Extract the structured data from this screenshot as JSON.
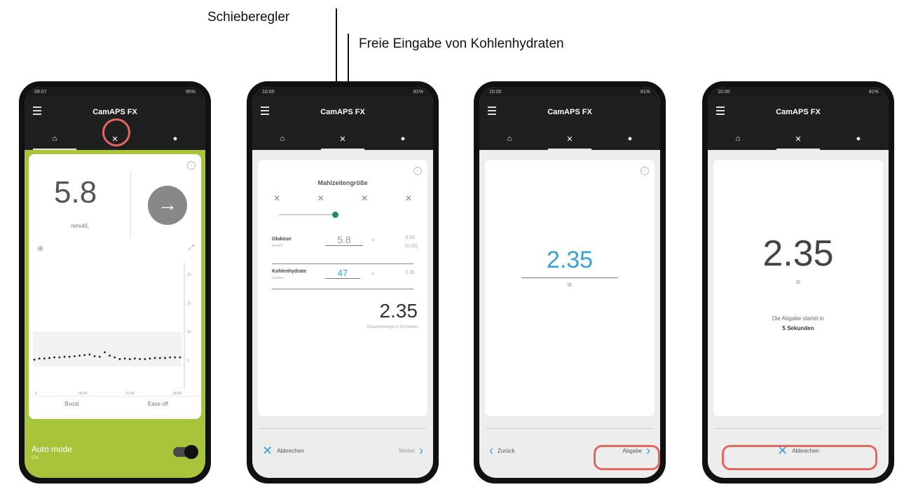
{
  "callouts": {
    "slider": "Schieberegler",
    "free_input": "Freie Eingabe von Kohlenhydraten"
  },
  "app": {
    "title": "CamAPS FX"
  },
  "screen1": {
    "status_left": "09:07",
    "status_right": "95%",
    "glucose_value": "5.8",
    "glucose_unit": "mmol/L",
    "y_ticks": [
      "20",
      "15",
      "10",
      "5"
    ],
    "x_ticks": [
      "3",
      "06:00",
      "07:00",
      "08:00"
    ],
    "boost_label": "Boost",
    "ease_off_label": "Ease off",
    "auto_mode_label": "Auto mode",
    "auto_mode_state": "On"
  },
  "screen2": {
    "status_left": "10:00",
    "status_right": "81%",
    "meal_size_title": "Mahlzeitengröße",
    "glucose_label": "Glukose",
    "glucose_sub": "mmol/L",
    "glucose_value": "5.8",
    "glucose_units": "0.00",
    "glucose_units2": "(0.00)",
    "carbs_label": "Kohlenhydrate",
    "carbs_sub": "Gramm",
    "carbs_value": "47",
    "carbs_units": "2.35",
    "total_value": "2.35",
    "total_label": "Gesamtmenge in Einheiten",
    "cancel_label": "Abbrechen",
    "next_label": "Weiter"
  },
  "screen3": {
    "status_left": "10:00",
    "status_right": "81%",
    "value": "2.35",
    "unit": "IE",
    "back_label": "Zurück",
    "deliver_label": "Abgabe"
  },
  "screen4": {
    "status_left": "10:00",
    "status_right": "81%",
    "value": "2.35",
    "unit": "IE",
    "delivery_text": "Die Abgabe startet in",
    "countdown_text": "5 Sekunden",
    "cancel_label": "Abbrechen"
  },
  "icons": {
    "home": "home-icon",
    "meal": "fork-knife-icon",
    "drop": "drop-icon",
    "arrow": "arrow-right-icon",
    "info": "info-icon"
  },
  "colors": {
    "accent_green": "#a7c43a",
    "value_blue": "#3aa0d8",
    "slider_teal": "#1b8a6e",
    "highlight_red": "#e4675e"
  },
  "chart_data": {
    "type": "line",
    "series": [
      {
        "values": [
          5.1,
          5.3,
          5.3,
          5.4,
          5.5,
          5.5,
          5.6,
          5.6,
          5.7,
          5.8,
          5.9,
          6.0,
          5.7,
          5.6,
          6.4,
          5.8,
          5.5,
          5.2,
          5.3,
          5.2,
          5.3,
          5.2,
          5.2,
          5.3,
          5.4,
          5.4,
          5.4,
          5.5,
          5.5,
          5.5
        ]
      }
    ],
    "x": [
      "3",
      "06:00",
      "07:00",
      "08:00"
    ],
    "ylim": [
      0,
      22
    ],
    "y_ticks": [
      5,
      10,
      15,
      20
    ]
  }
}
